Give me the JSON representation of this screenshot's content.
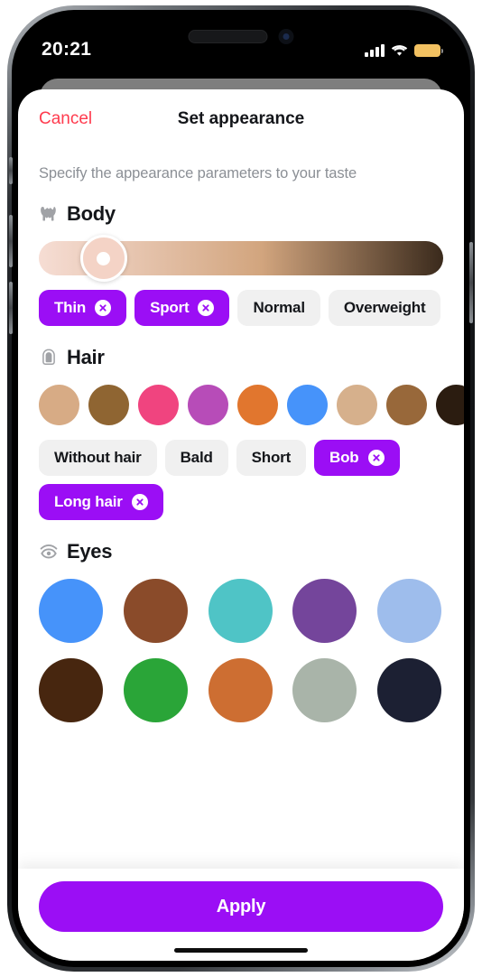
{
  "status_bar": {
    "time": "20:21",
    "signal_icon": "cellular-signal-icon",
    "wifi_icon": "wifi-icon",
    "battery_icon": "battery-icon",
    "battery_color": "#f2c161"
  },
  "header": {
    "cancel_label": "Cancel",
    "cancel_color": "#ff3b4e",
    "title": "Set appearance"
  },
  "subtitle": "Specify the appearance parameters to your taste",
  "accent_color": "#9b0ef5",
  "chip_idle_bg": "#f0f0f0",
  "sections": [
    {
      "id": "body",
      "icon": "body-icon",
      "title": "Body",
      "skin_slider": {
        "gradient_from": "#f6ddd4",
        "gradient_mid": "#d2a57e",
        "gradient_to": "#3a2a1c",
        "thumb_position_percent": 16,
        "thumb_color": "#f4d3c6"
      },
      "chips": [
        {
          "label": "Thin",
          "selected": true
        },
        {
          "label": "Sport",
          "selected": true
        },
        {
          "label": "Normal",
          "selected": false
        },
        {
          "label": "Overweight",
          "selected": false
        }
      ]
    },
    {
      "id": "hair",
      "icon": "hair-icon",
      "title": "Hair",
      "colors": [
        "#d7ab85",
        "#8f6532",
        "#f0447f",
        "#b74cb8",
        "#e1762e",
        "#4693fa",
        "#d6b08c",
        "#98683a",
        "#2b1c10",
        "#2a2a2a"
      ],
      "chips": [
        {
          "label": "Without hair",
          "selected": false
        },
        {
          "label": "Bald",
          "selected": false
        },
        {
          "label": "Short",
          "selected": false
        },
        {
          "label": "Bob",
          "selected": true
        },
        {
          "label": "Long hair",
          "selected": true
        }
      ]
    },
    {
      "id": "eyes",
      "icon": "eyes-icon",
      "title": "Eyes",
      "colors": [
        "#4693fa",
        "#8a4b2a",
        "#4fc4c6",
        "#74459b",
        "#9ebdec",
        "#47260f",
        "#2aa538",
        "#cd6e32",
        "#a9b4a9",
        "#1c2033"
      ]
    }
  ],
  "footer": {
    "apply_label": "Apply"
  }
}
